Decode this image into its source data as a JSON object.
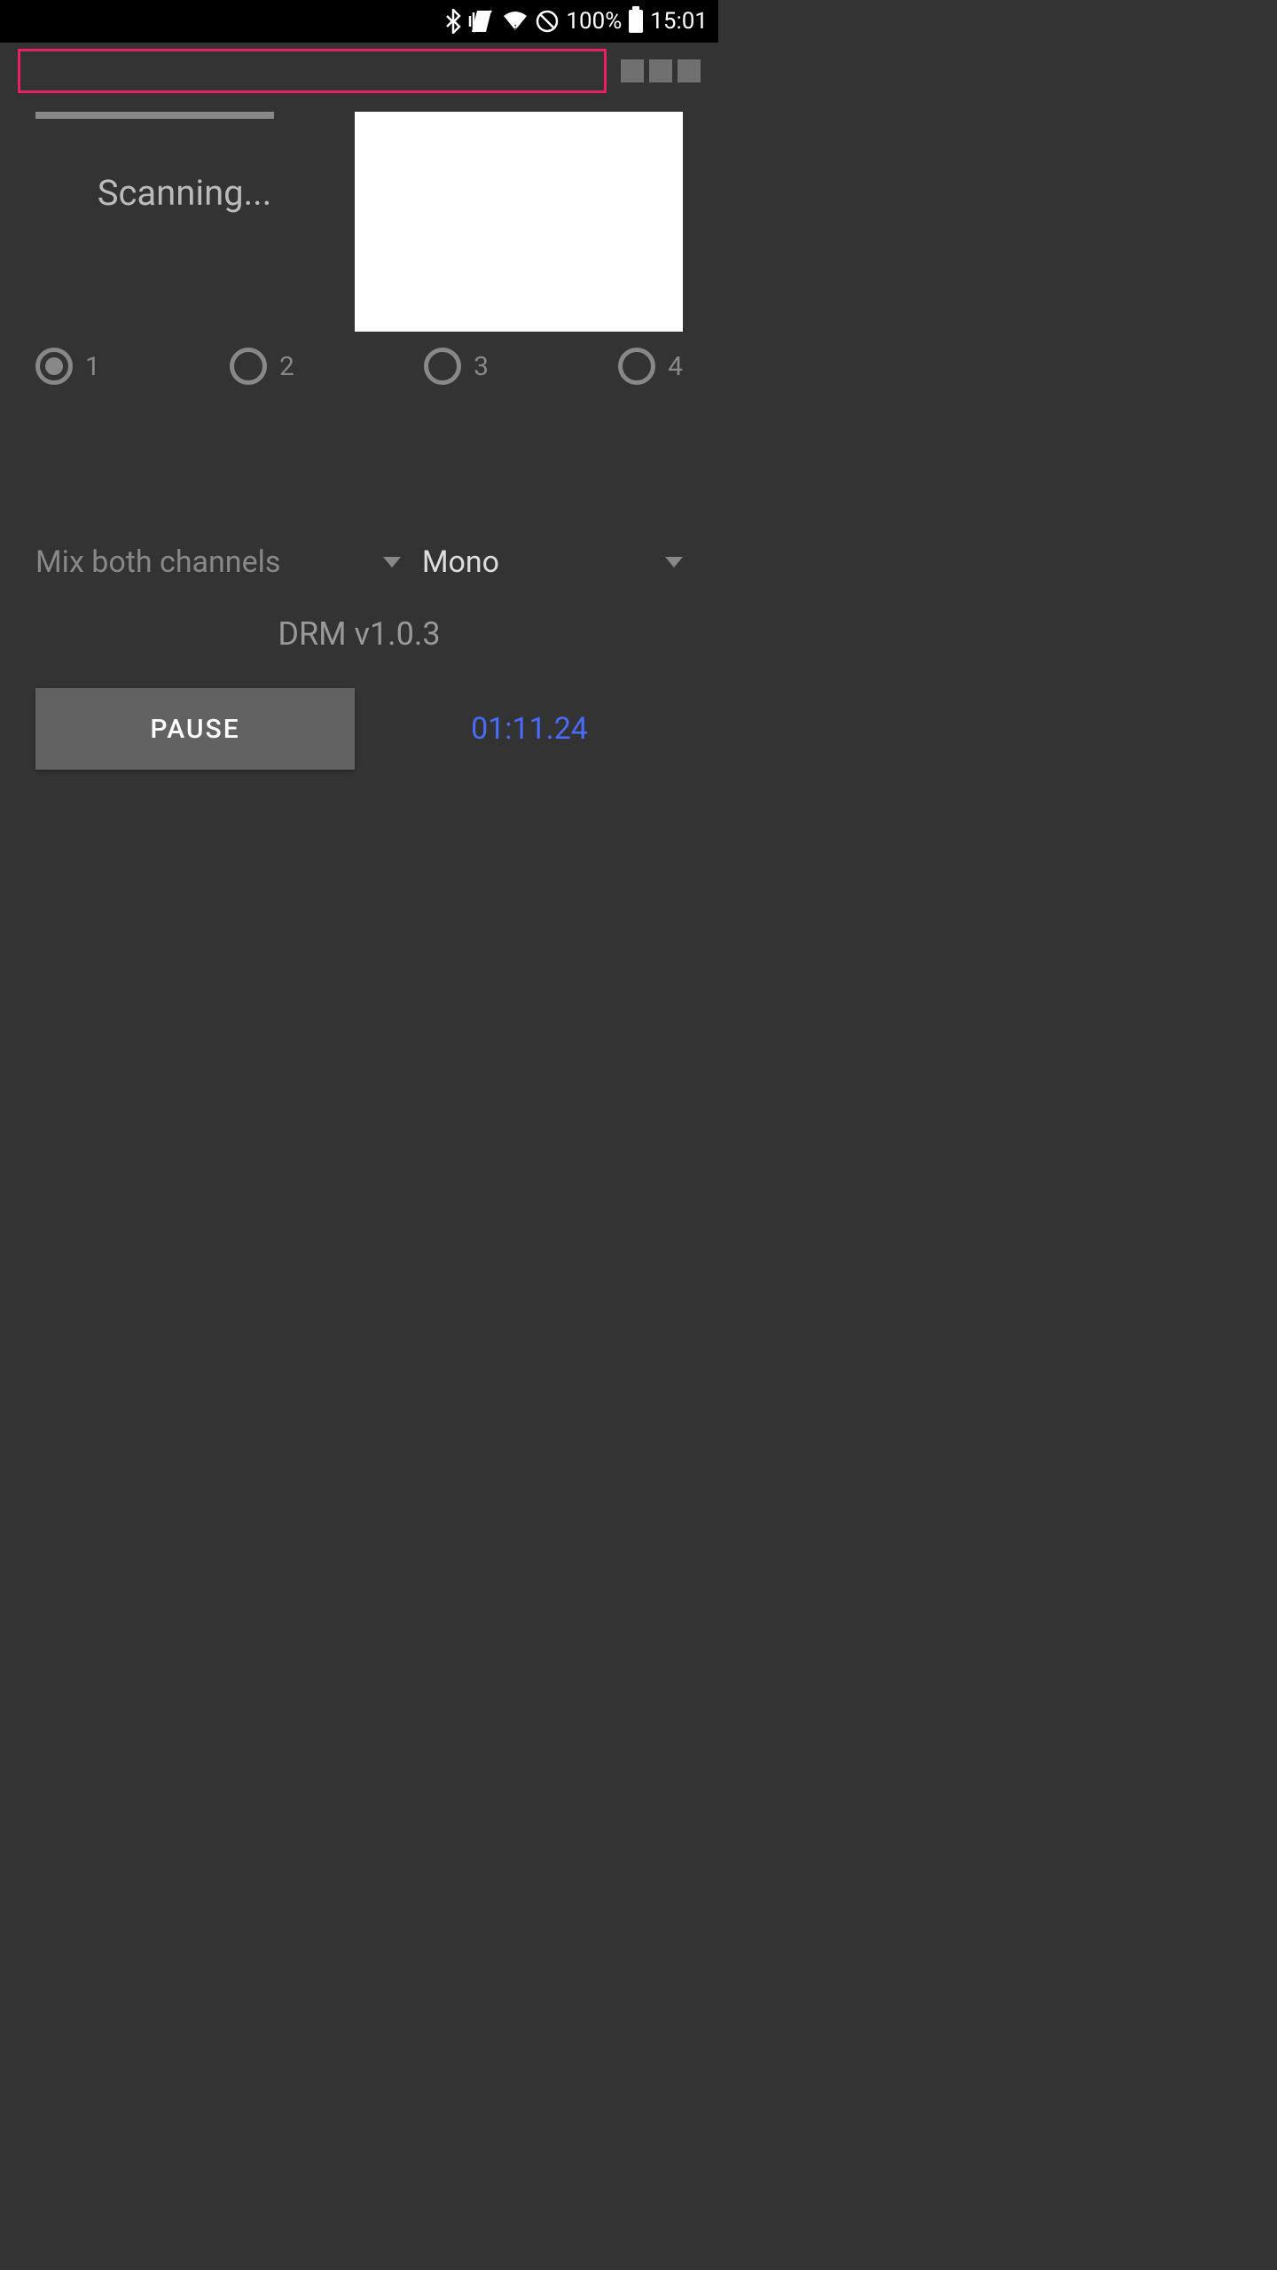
{
  "status_bar": {
    "battery_percent": "100%",
    "time": "15:01"
  },
  "main": {
    "scanning_label": "Scanning...",
    "radios": [
      {
        "label": "1",
        "selected": true
      },
      {
        "label": "2",
        "selected": false
      },
      {
        "label": "3",
        "selected": false
      },
      {
        "label": "4",
        "selected": false
      }
    ],
    "mix_dropdown": {
      "value": "Mix both channels"
    },
    "mono_dropdown": {
      "value": "Mono"
    },
    "version": "DRM v1.0.3",
    "pause_button": "PAUSE",
    "timer": "01:11.24"
  }
}
